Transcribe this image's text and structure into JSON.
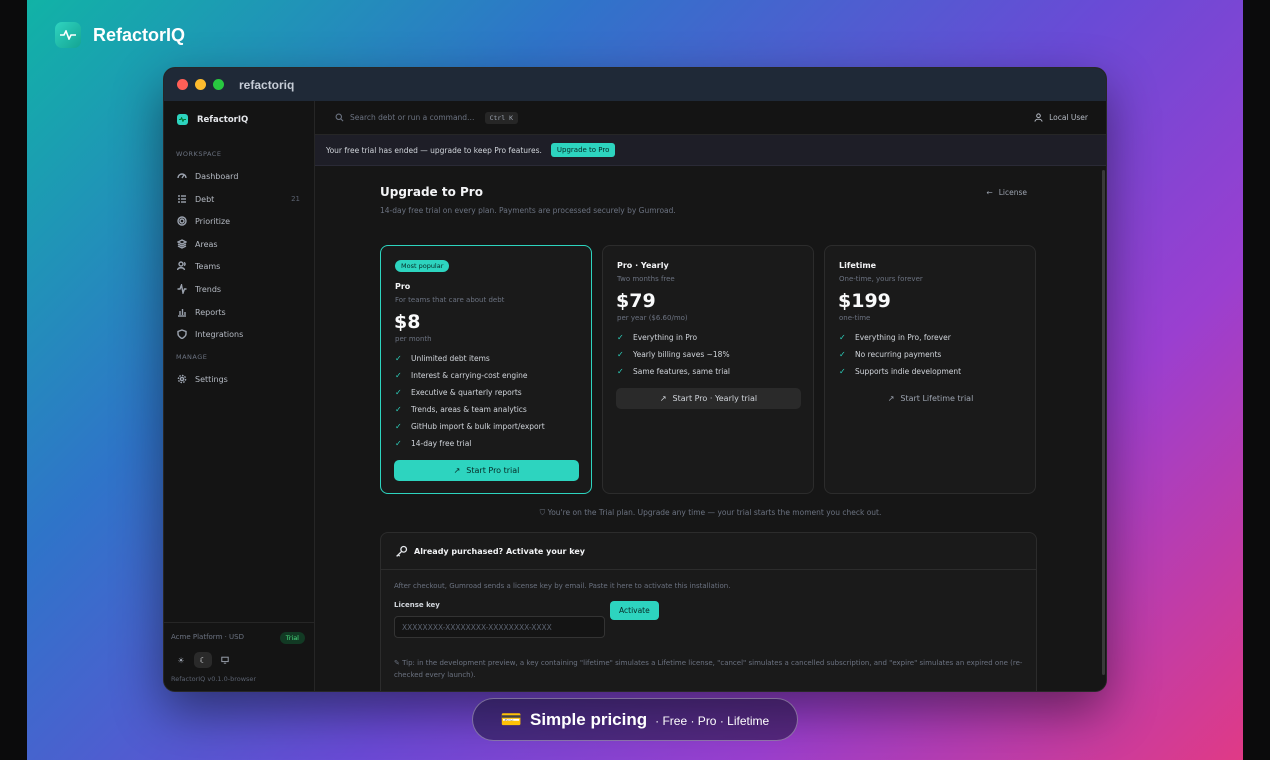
{
  "brand": {
    "name": "RefactorIQ"
  },
  "window": {
    "title": "refactoriq"
  },
  "sidebar": {
    "app_name": "RefactorIQ",
    "section_workspace": "WORKSPACE",
    "section_manage": "MANAGE",
    "items": [
      {
        "label": "Dashboard",
        "icon": "gauge-icon"
      },
      {
        "label": "Debt",
        "icon": "list-icon",
        "count": "21"
      },
      {
        "label": "Prioritize",
        "icon": "target-icon"
      },
      {
        "label": "Areas",
        "icon": "layers-icon"
      },
      {
        "label": "Teams",
        "icon": "users-icon"
      },
      {
        "label": "Trends",
        "icon": "activity-icon"
      },
      {
        "label": "Reports",
        "icon": "bar-chart-icon"
      },
      {
        "label": "Integrations",
        "icon": "shield-icon"
      }
    ],
    "manage_items": [
      {
        "label": "Settings",
        "icon": "gear-icon"
      }
    ],
    "org": "Acme Platform · USD",
    "plan_badge": "Trial",
    "version": "RefactorIQ v0.1.0-browser"
  },
  "topbar": {
    "search_placeholder": "Search debt or run a command…",
    "shortcut": "Ctrl K",
    "user": "Local User"
  },
  "banner": {
    "text": "Your free trial has ended — upgrade to keep Pro features.",
    "button": "Upgrade to Pro"
  },
  "page": {
    "title": "Upgrade to Pro",
    "subtitle": "14-day free trial on every plan. Payments are processed securely by Gumroad.",
    "back_link": "License"
  },
  "plans": [
    {
      "badge": "Most popular",
      "name": "Pro",
      "tagline": "For teams that care about debt",
      "price": "$8",
      "period": "per month",
      "features": [
        "Unlimited debt items",
        "Interest & carrying-cost engine",
        "Executive & quarterly reports",
        "Trends, areas & team analytics",
        "GitHub import & bulk import/export",
        "14-day free trial"
      ],
      "cta": "Start Pro trial"
    },
    {
      "name": "Pro · Yearly",
      "tagline": "Two months free",
      "price": "$79",
      "period": "per year ($6.60/mo)",
      "features": [
        "Everything in Pro",
        "Yearly billing saves ~18%",
        "Same features, same trial"
      ],
      "cta": "Start Pro · Yearly trial"
    },
    {
      "name": "Lifetime",
      "tagline": "One-time, yours forever",
      "price": "$199",
      "period": "one-time",
      "features": [
        "Everything in Pro, forever",
        "No recurring payments",
        "Supports indie development"
      ],
      "cta": "Start Lifetime trial"
    }
  ],
  "trial_note": "You're on the Trial plan. Upgrade any time — your trial starts the moment you check out.",
  "activate": {
    "title": "Already purchased? Activate your key",
    "description": "After checkout, Gumroad sends a license key by email. Paste it here to activate this installation.",
    "label": "License key",
    "placeholder": "XXXXXXXX-XXXXXXXX-XXXXXXXX-XXXX",
    "button": "Activate",
    "tip": "Tip: in the development preview, a key containing \"lifetime\" simulates a Lifetime license, \"cancel\" simulates a cancelled subscription, and \"expire\" simulates an expired one (re-checked every launch)."
  },
  "caption": {
    "emoji": "💳",
    "title": "Simple pricing",
    "subtitle": "· Free · Pro · Lifetime"
  },
  "colors": {
    "accent": "#2dd4bf",
    "background": "#161616"
  }
}
